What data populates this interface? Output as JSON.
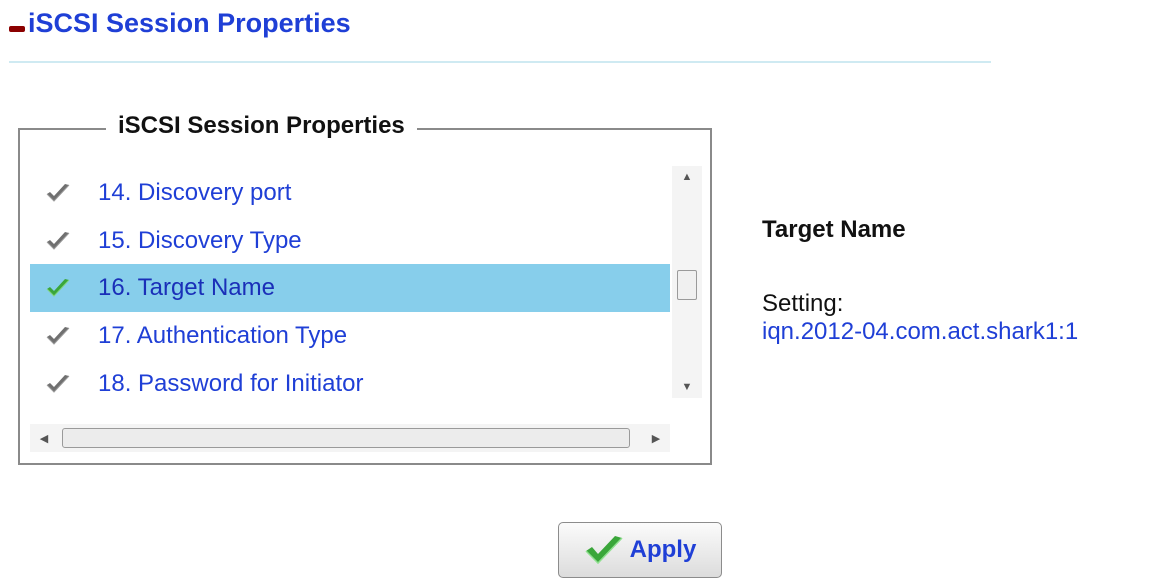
{
  "header": {
    "title": "iSCSI Session Properties"
  },
  "groupbox": {
    "legend": "iSCSI Session Properties",
    "items": [
      {
        "label": "14. Discovery port",
        "selected": false,
        "icon": "check-icon-gray"
      },
      {
        "label": "15. Discovery Type",
        "selected": false,
        "icon": "check-icon-gray"
      },
      {
        "label": "16. Target Name",
        "selected": true,
        "icon": "check-icon-green"
      },
      {
        "label": "17. Authentication Type",
        "selected": false,
        "icon": "check-icon-gray"
      },
      {
        "label": "18. Password for Initiator",
        "selected": false,
        "icon": "check-icon-gray"
      }
    ]
  },
  "detail": {
    "title": "Target Name",
    "setting_label": "Setting:",
    "setting_value": "iqn.2012-04.com.act.shark1:1"
  },
  "apply": {
    "label": "Apply",
    "icon": "check-icon-green"
  },
  "colors": {
    "link_blue": "#1f3fd6",
    "selection": "#87ceeb",
    "header_mark": "#8b0000"
  }
}
